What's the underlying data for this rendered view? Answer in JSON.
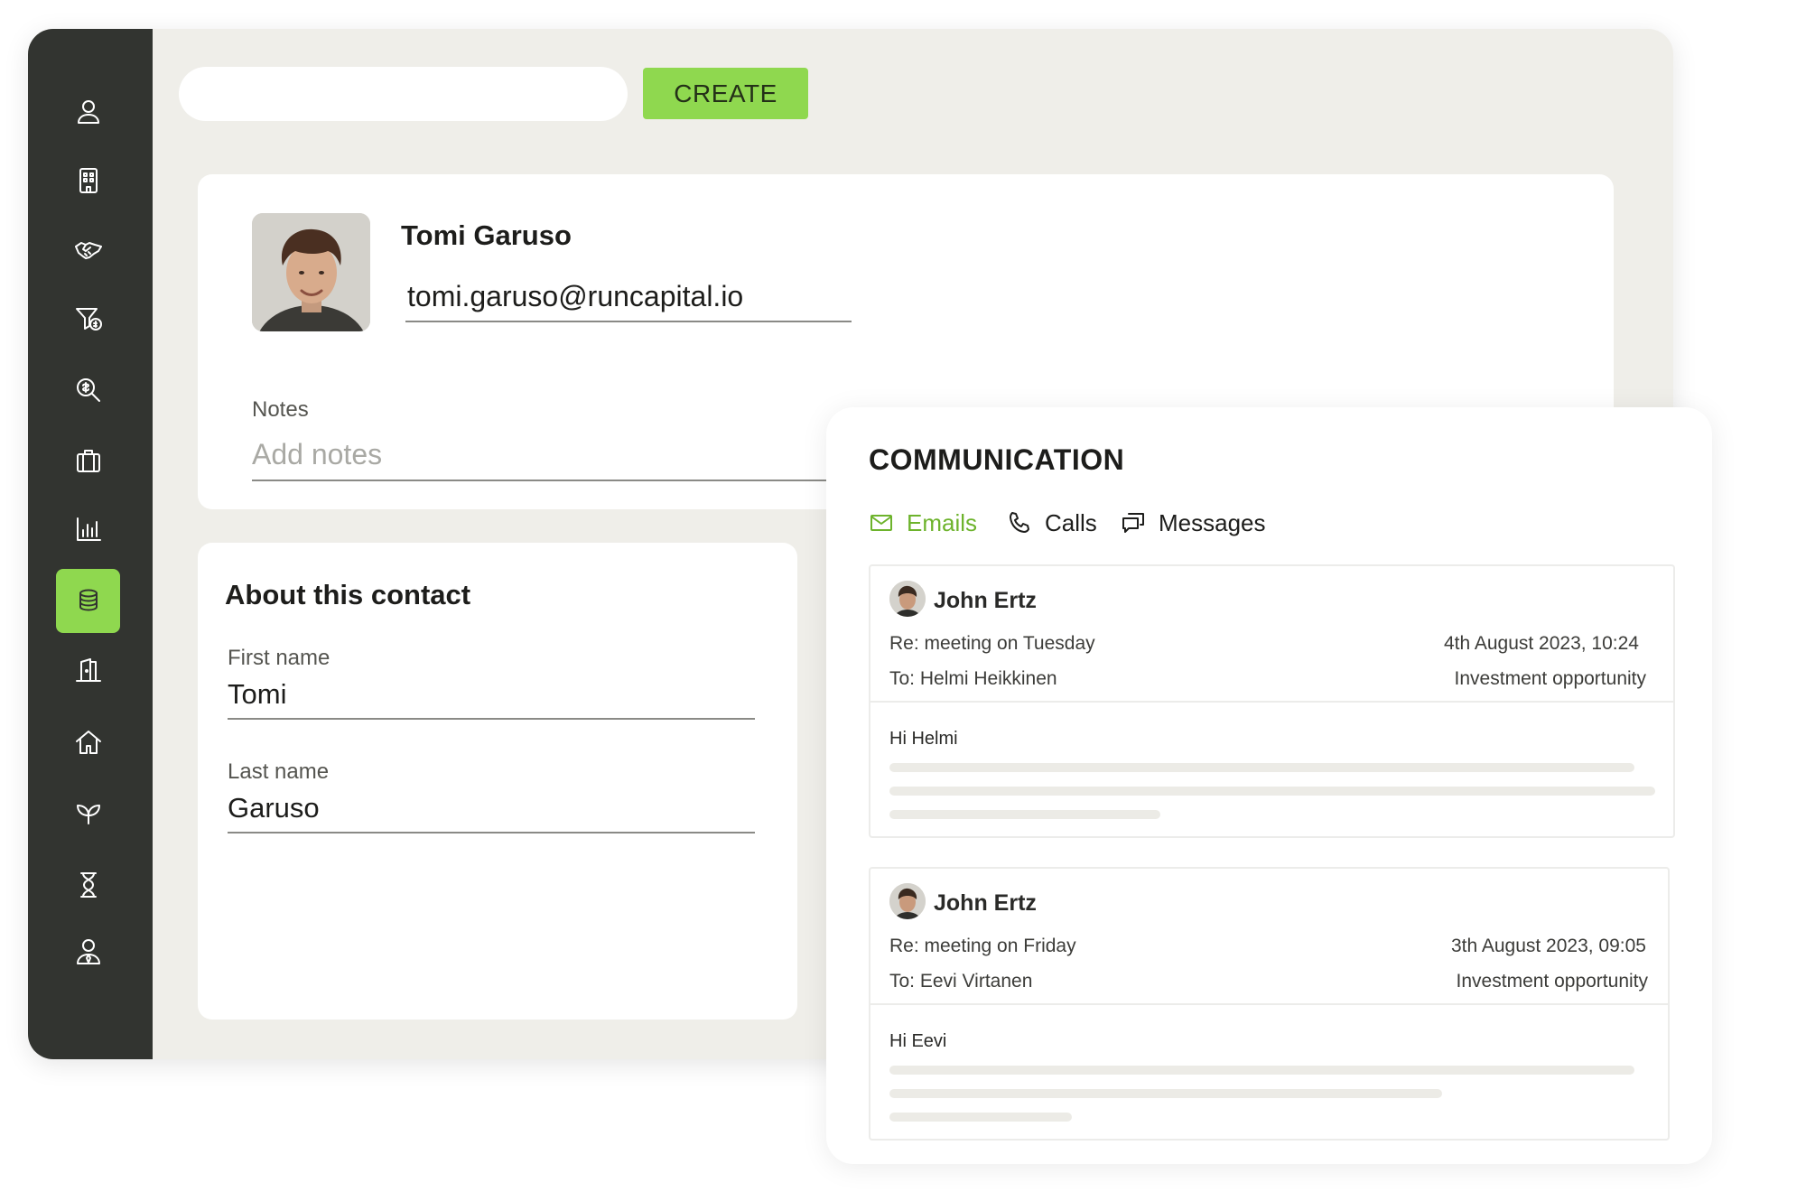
{
  "sidebar": {
    "items": [
      {
        "name": "contacts",
        "icon": "person-icon"
      },
      {
        "name": "companies",
        "icon": "building-icon"
      },
      {
        "name": "deals",
        "icon": "handshake-icon"
      },
      {
        "name": "funnel",
        "icon": "filter-dollar-icon"
      },
      {
        "name": "search-funds",
        "icon": "magnify-dollar-icon"
      },
      {
        "name": "portfolio",
        "icon": "briefcase-icon"
      },
      {
        "name": "reports",
        "icon": "bar-chart-icon"
      },
      {
        "name": "finance",
        "icon": "coins-stack-icon",
        "active": true
      },
      {
        "name": "offices",
        "icon": "door-icon"
      },
      {
        "name": "home",
        "icon": "home-icon"
      },
      {
        "name": "sustainability",
        "icon": "leaf-icon"
      },
      {
        "name": "history",
        "icon": "hourglass-icon"
      },
      {
        "name": "users",
        "icon": "user-tie-icon"
      }
    ],
    "accent": "#8fd84f",
    "background": "#323430"
  },
  "toolbar": {
    "search_value": "",
    "create_label": "CREATE"
  },
  "profile": {
    "name": "Tomi Garuso",
    "email": "tomi.garuso@runcapital.io",
    "notes_label": "Notes",
    "notes_placeholder": "Add notes"
  },
  "about": {
    "title": "About this contact",
    "first_name_label": "First name",
    "first_name": "Tomi",
    "last_name_label": "Last name",
    "last_name": "Garuso"
  },
  "communication": {
    "title": "COMMUNICATION",
    "tabs": [
      {
        "label": "Emails",
        "icon": "mail-icon",
        "active": true
      },
      {
        "label": "Calls",
        "icon": "phone-icon",
        "active": false
      },
      {
        "label": "Messages",
        "icon": "chat-icon",
        "active": false
      }
    ],
    "emails": [
      {
        "sender": "John Ertz",
        "subject": "Re: meeting on Tuesday",
        "date": "4th August 2023, 10:24",
        "to": "To: Helmi Heikkinen",
        "category": "Investment opportunity",
        "greeting": "Hi Helmi"
      },
      {
        "sender": "John Ertz",
        "subject": "Re: meeting on Friday",
        "date": "3th August 2023, 09:05",
        "to": "To: Eevi Virtanen",
        "category": "Investment opportunity",
        "greeting": "Hi Eevi"
      }
    ],
    "accent": "#6db32c"
  }
}
